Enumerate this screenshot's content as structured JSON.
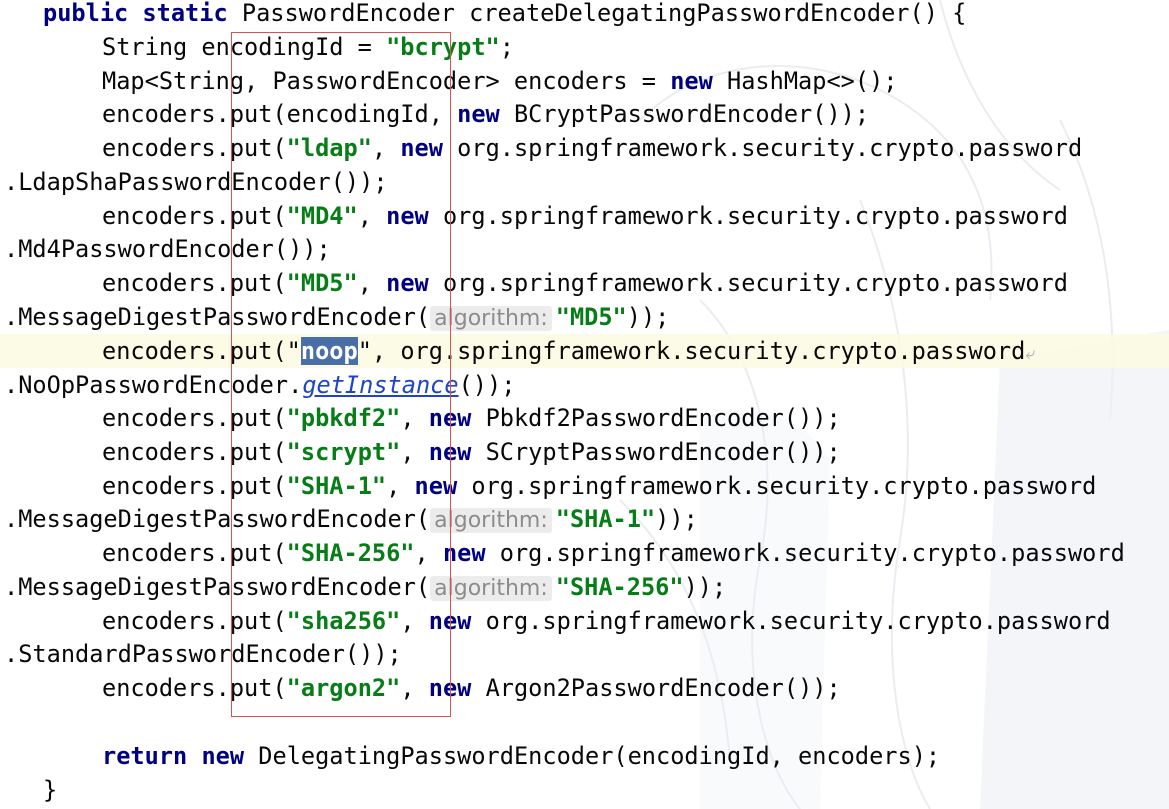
{
  "code": {
    "l01_kw": "public static",
    "l01_rest": " PasswordEncoder createDelegatingPasswordEncoder() {",
    "l02_a": "String encodingId = ",
    "l02_str": "\"bcrypt\"",
    "l02_b": ";",
    "l03_a": "Map<String, PasswordEncoder> encoders = ",
    "l03_kw": "new",
    "l03_b": " HashMap<>();",
    "l04_a": "encoders.put(encodingId, ",
    "l04_kw": "new",
    "l04_b": " BCryptPasswordEncoder());",
    "l05_a": "encoders.put(",
    "l05_str": "\"ldap\"",
    "l05_b": ", ",
    "l05_kw": "new",
    "l05_c": " org.springframework.security.crypto.password",
    "l06": ".LdapShaPasswordEncoder());",
    "l07_a": "encoders.put(",
    "l07_str": "\"MD4\"",
    "l07_b": ", ",
    "l07_kw": "new",
    "l07_c": " org.springframework.security.crypto.password",
    "l08": ".Md4PasswordEncoder());",
    "l09_a": "encoders.put(",
    "l09_str": "\"MD5\"",
    "l09_b": ", ",
    "l09_kw": "new",
    "l09_c": " org.springframework.security.crypto.password",
    "l10_a": ".MessageDigestPasswordEncoder(",
    "l10_hint": "algorithm:",
    "l10_str": "\"MD5\"",
    "l10_b": "));",
    "l11_a": "encoders.put(\"",
    "l11_sel": "noop",
    "l11_b": "\", org.springframework.security.crypto.password",
    "l11_wrap": "⤶",
    "l12_a": ".NoOpPasswordEncoder.",
    "l12_call": "getInstance",
    "l12_b": "());",
    "l13_a": "encoders.put(",
    "l13_str": "\"pbkdf2\"",
    "l13_b": ", ",
    "l13_kw": "new",
    "l13_c": " Pbkdf2PasswordEncoder());",
    "l14_a": "encoders.put(",
    "l14_str": "\"scrypt\"",
    "l14_b": ", ",
    "l14_kw": "new",
    "l14_c": " SCryptPasswordEncoder());",
    "l15_a": "encoders.put(",
    "l15_str": "\"SHA-1\"",
    "l15_b": ", ",
    "l15_kw": "new",
    "l15_c": " org.springframework.security.crypto.password",
    "l16_a": ".MessageDigestPasswordEncoder(",
    "l16_hint": "algorithm:",
    "l16_str": "\"SHA-1\"",
    "l16_b": "));",
    "l17_a": "encoders.put(",
    "l17_str": "\"SHA-256\"",
    "l17_b": ", ",
    "l17_kw": "new",
    "l17_c": " org.springframework.security.crypto.password",
    "l18_a": ".MessageDigestPasswordEncoder(",
    "l18_hint": "algorithm:",
    "l18_str": "\"SHA-256\"",
    "l18_b": "));",
    "l19_a": "encoders.put(",
    "l19_str": "\"sha256\"",
    "l19_b": ", ",
    "l19_kw": "new",
    "l19_c": " org.springframework.security.crypto.password",
    "l20": ".StandardPasswordEncoder());",
    "l21_a": "encoders.put(",
    "l21_str": "\"argon2\"",
    "l21_b": ", ",
    "l21_kw": "new",
    "l21_c": " Argon2PasswordEncoder());",
    "l23_kw1": "return",
    "l23_a": " ",
    "l23_kw2": "new",
    "l23_b": " DelegatingPasswordEncoder(encodingId, encoders);",
    "l24": "}"
  },
  "colors": {
    "keyword": "#000080",
    "string": "#067d17",
    "selection": "#4a6fa6",
    "annotation_box": "#e05050",
    "current_line": "#fcfae1"
  },
  "icons": {
    "soft_wrap": "soft-wrap-icon"
  }
}
